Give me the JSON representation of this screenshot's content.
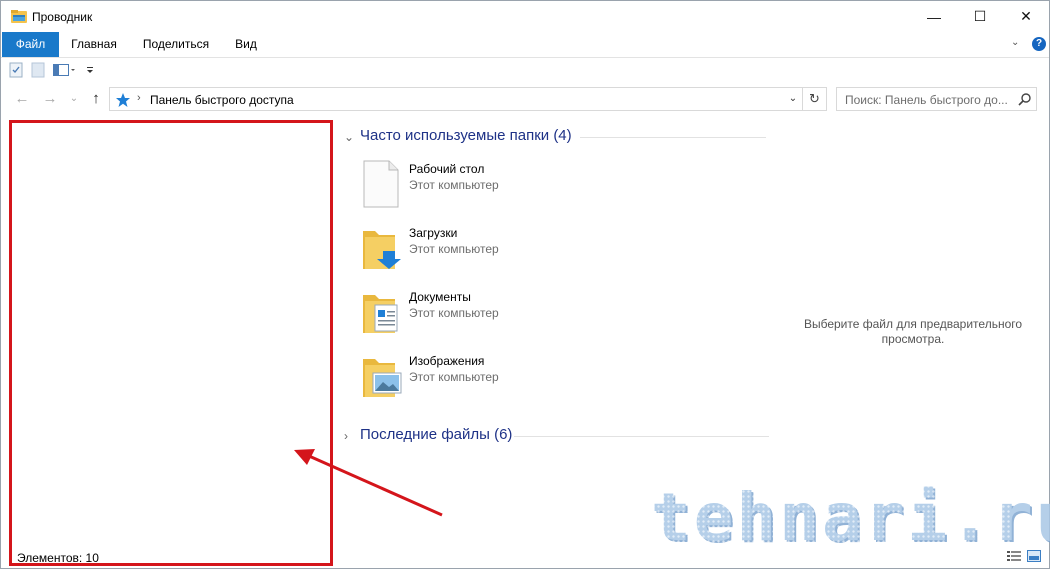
{
  "window": {
    "title": "Проводник",
    "minimize_symbol": "—",
    "maximize_symbol": "☐",
    "close_symbol": "✕"
  },
  "ribbon": {
    "tabs": [
      "Файл",
      "Главная",
      "Поделиться",
      "Вид"
    ],
    "expand_symbol": "⌄",
    "help_label": "?"
  },
  "navigation": {
    "back_symbol": "←",
    "forward_symbol": "→",
    "recent_symbol": "⌄",
    "up_symbol": "↑",
    "separator": "›",
    "address": "Панель быстрого доступа",
    "dropdown_symbol": "⌄",
    "refresh_symbol": "↻",
    "search_placeholder": "Поиск: Панель быстрого до..."
  },
  "status": {
    "item_count": "Элементов: 10"
  },
  "groups": {
    "frequent": {
      "title": "Часто используемые папки (4)",
      "chevron": "⌄",
      "items": [
        {
          "name": "Рабочий стол",
          "location": "Этот компьютер",
          "icon": "desktop-file-icon"
        },
        {
          "name": "Загрузки",
          "location": "Этот компьютер",
          "icon": "downloads-folder-icon"
        },
        {
          "name": "Документы",
          "location": "Этот компьютер",
          "icon": "documents-folder-icon"
        },
        {
          "name": "Изображения",
          "location": "Этот компьютер",
          "icon": "pictures-folder-icon"
        }
      ]
    },
    "recent": {
      "title": "Последние файлы (6)",
      "chevron": "›"
    }
  },
  "preview": {
    "line1": "Выберите файл для предварительного",
    "line2": "просмотра."
  },
  "watermark": {
    "text": "tehnari.ru"
  },
  "colors": {
    "file_tab": "#1979ca",
    "highlight": "#d4151b",
    "group_title": "#1e3287",
    "folder": "#f5cf63"
  }
}
